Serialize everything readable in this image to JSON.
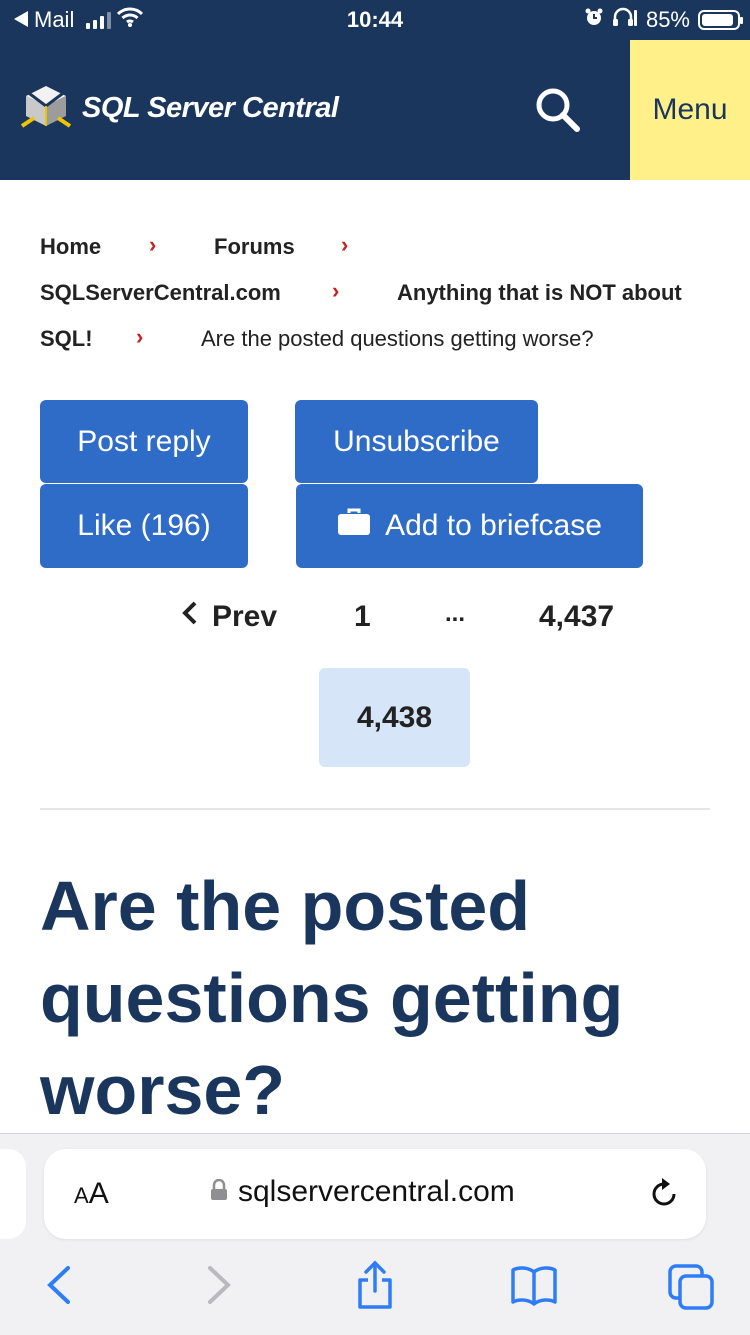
{
  "status_bar": {
    "back_app": "Mail",
    "time": "10:44",
    "battery": "85%",
    "battery_level": 0.85
  },
  "header": {
    "logo_text": "SQL Server Central",
    "search_icon": "search-icon",
    "menu_label": "Menu",
    "colors": {
      "navy": "#1b365d",
      "menu_bg": "#fff08a"
    }
  },
  "breadcrumb": {
    "home": "Home",
    "forums": "Forums",
    "site": "SQLServerCentral.com",
    "category_part1": "Anything that is NOT about",
    "category_part2": "SQL!",
    "current": "Are the posted questions getting worse?"
  },
  "actions": {
    "post_reply": "Post reply",
    "unsubscribe": "Unsubscribe",
    "like": "Like (196)",
    "add_to_briefcase": "Add to briefcase",
    "color": "#2f6cc8"
  },
  "pagination": {
    "prev": "Prev",
    "first": "1",
    "ellipsis": "...",
    "previous_page": "4,437",
    "current_page": "4,438"
  },
  "topic": {
    "title": "Are the posted questions getting worse?"
  },
  "browser": {
    "text_size_label": "AA",
    "url": "sqlservercentral.com"
  }
}
